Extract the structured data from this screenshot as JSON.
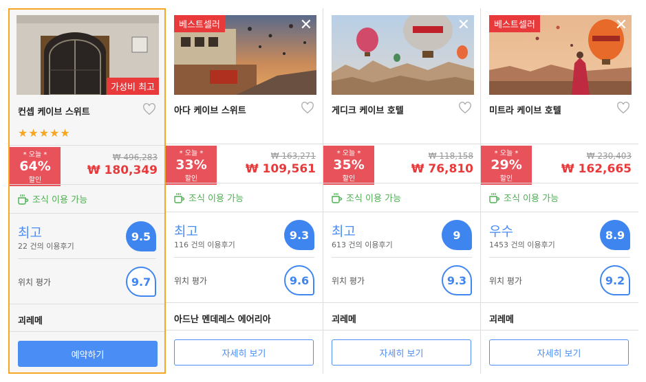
{
  "cards": [
    {
      "name": "컨셉 케이브 스위트",
      "badge_best": "",
      "badge_value": "가성비 최고",
      "stars": "★★★★★",
      "discount_top": "* 오늘 *",
      "discount_pct": "64%",
      "discount_bottom": "할인",
      "original_price": "₩ 496,283",
      "price": "₩ 180,349",
      "breakfast": "조식 이용 가능",
      "grade": "최고",
      "reviews": "22 건의 이용후기",
      "score": "9.5",
      "location_label": "위치 평가",
      "location_score": "9.7",
      "area": "괴레메",
      "button": "예약하기"
    },
    {
      "name": "아다 케이브 스위트",
      "badge_best": "베스트셀러",
      "badge_value": "",
      "stars": "",
      "discount_top": "* 오늘 *",
      "discount_pct": "33%",
      "discount_bottom": "할인",
      "original_price": "₩ 163,271",
      "price": "₩ 109,561",
      "breakfast": "조식 이용 가능",
      "grade": "최고",
      "reviews": "116 건의 이용후기",
      "score": "9.3",
      "location_label": "위치 평가",
      "location_score": "9.6",
      "area": "아드난 멘데레스 에어리아",
      "button": "자세히 보기"
    },
    {
      "name": "게디크 케이브 호텔",
      "badge_best": "",
      "badge_value": "",
      "stars": "",
      "discount_top": "* 오늘 *",
      "discount_pct": "35%",
      "discount_bottom": "할인",
      "original_price": "₩ 118,158",
      "price": "₩ 76,810",
      "breakfast": "조식 이용 가능",
      "grade": "최고",
      "reviews": "613 건의 이용후기",
      "score": "9",
      "location_label": "위치 평가",
      "location_score": "9.3",
      "area": "괴레메",
      "button": "자세히 보기"
    },
    {
      "name": "미트라 케이브 호텔",
      "badge_best": "베스트셀러",
      "badge_value": "",
      "stars": "",
      "discount_top": "* 오늘 *",
      "discount_pct": "29%",
      "discount_bottom": "할인",
      "original_price": "₩ 230,403",
      "price": "₩ 162,665",
      "breakfast": "조식 이용 가능",
      "grade": "우수",
      "reviews": "1453 건의 이용후기",
      "score": "8.9",
      "location_label": "위치 평가",
      "location_score": "9.2",
      "area": "괴레메",
      "button": "자세히 보기"
    }
  ],
  "colors": {
    "accent": "#4a8ef5",
    "score": "#3f85f0",
    "discount": "#e8525a",
    "badge": "#e8393b",
    "breakfast": "#4caf50",
    "selected_border": "#f5a623",
    "stars": "#f5a623"
  },
  "icons": {
    "heart": "heart-outline-icon",
    "close": "close-icon",
    "breakfast": "coffee-cup-icon",
    "star": "star-icon"
  }
}
